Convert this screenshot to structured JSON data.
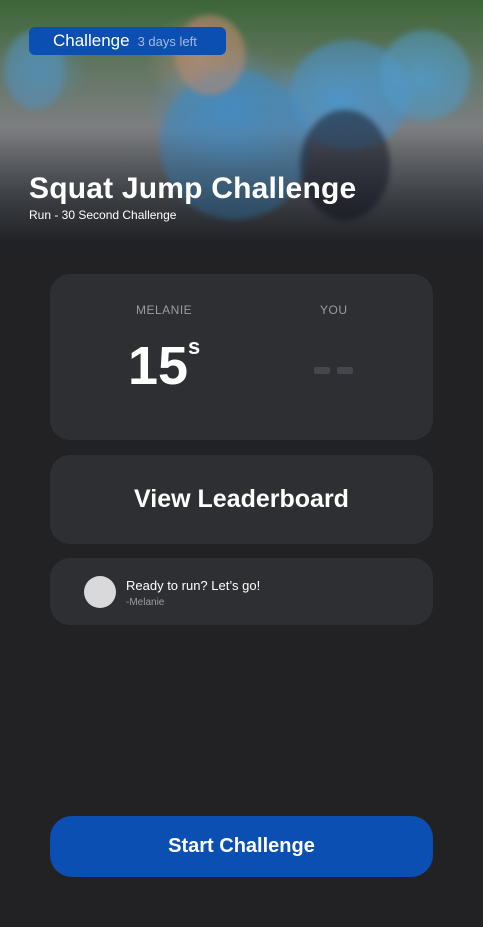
{
  "hero": {
    "badge_label": "Challenge",
    "badge_time": "3 days left",
    "title": "Squat Jump Challenge",
    "subtitle": "Run - 30 Second Challenge"
  },
  "score": {
    "opponent_label": "MELANIE",
    "you_label": "YOU",
    "opponent_value": "15",
    "opponent_unit": "s"
  },
  "leaderboard": {
    "label": "View Leaderboard"
  },
  "message": {
    "text": "Ready to run? Let’s go!",
    "author": "-Melanie"
  },
  "actions": {
    "start_label": "Start Challenge"
  },
  "colors": {
    "accent": "#0a4fb1",
    "background": "#222224",
    "card": "#2d2f33"
  }
}
